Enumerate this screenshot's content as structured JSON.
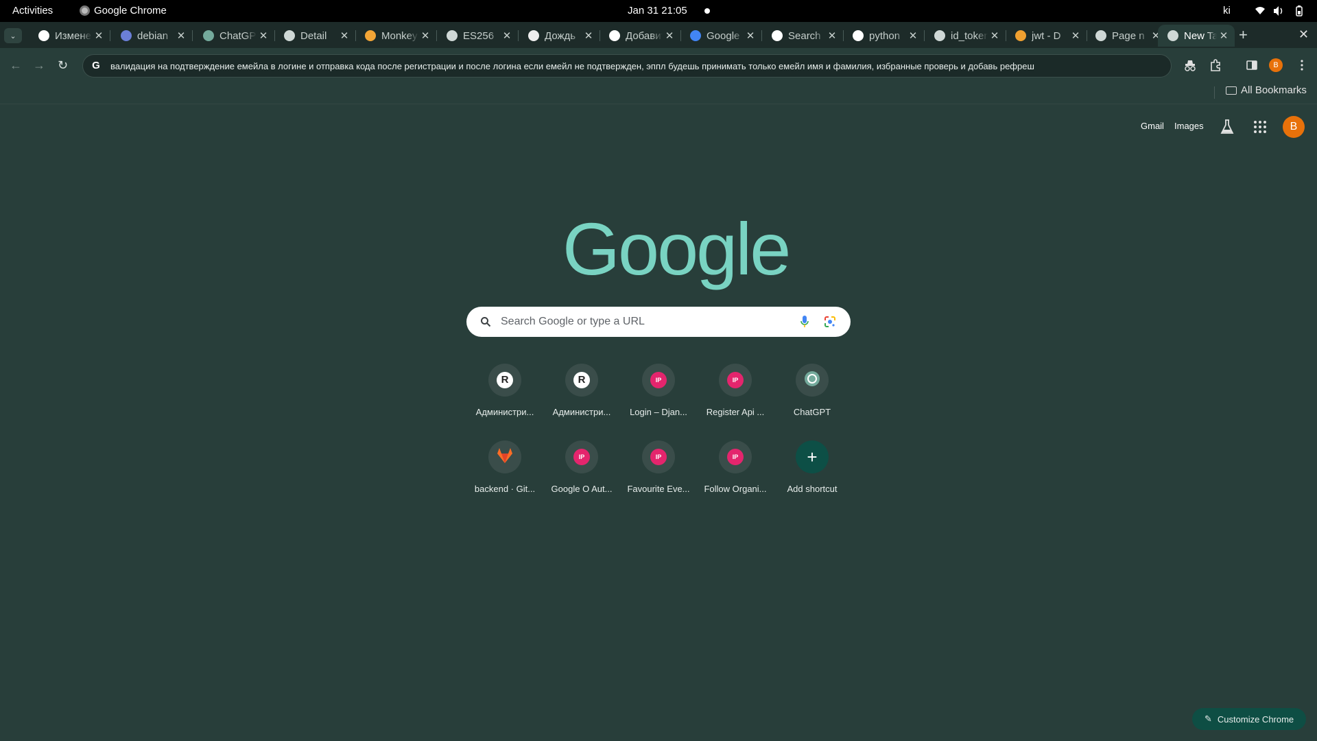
{
  "system_bar": {
    "activities": "Activities",
    "app_name": "Google Chrome",
    "clock": "Jan 31  21:05",
    "keyboard_layout": "ki"
  },
  "tabs": [
    {
      "title": "Изменение",
      "favicon": "R"
    },
    {
      "title": "debian",
      "favicon": "debian"
    },
    {
      "title": "ChatGPT",
      "favicon": "chatgpt"
    },
    {
      "title": "Detail",
      "favicon": "globe"
    },
    {
      "title": "Monkey",
      "favicon": "mt"
    },
    {
      "title": "ES256",
      "favicon": "apple"
    },
    {
      "title": "Дождь",
      "favicon": "image"
    },
    {
      "title": "Добавить",
      "favicon": "R"
    },
    {
      "title": "Google",
      "favicon": "translate"
    },
    {
      "title": "Search",
      "favicon": "cube"
    },
    {
      "title": "python",
      "favicon": "google"
    },
    {
      "title": "id_token",
      "favicon": "apple"
    },
    {
      "title": "jwt - D",
      "favicon": "flame"
    },
    {
      "title": "Page n",
      "favicon": "globe"
    },
    {
      "title": "New Tab",
      "favicon": "chrome",
      "active": true
    }
  ],
  "omnibox": {
    "text": "валидация на подтверждение емейла в логине и отправка кода после регистрации и после логина если емейл не подтвержден, эппл будешь принимать только емейл имя и фамилия, избранные проверь  и добавь рефреш"
  },
  "profile_initial": "B",
  "bookmarks_bar": {
    "all_bookmarks": "All Bookmarks"
  },
  "ntp": {
    "gmail": "Gmail",
    "images": "Images",
    "logo": "Google",
    "search_placeholder": "Search Google or type a URL",
    "shortcuts": [
      {
        "label": "Администри...",
        "icon": "R"
      },
      {
        "label": "Администри...",
        "icon": "R"
      },
      {
        "label": "Login – Djan...",
        "icon": "IP"
      },
      {
        "label": "Register Api ...",
        "icon": "IP"
      },
      {
        "label": "ChatGPT",
        "icon": "chatgpt"
      },
      {
        "label": "backend · Git...",
        "icon": "gitlab"
      },
      {
        "label": "Google O Aut...",
        "icon": "IP"
      },
      {
        "label": "Favourite Eve...",
        "icon": "IP"
      },
      {
        "label": "Follow Organi...",
        "icon": "IP"
      },
      {
        "label": "Add shortcut",
        "icon": "plus"
      }
    ],
    "customize": "Customize Chrome"
  },
  "colors": {
    "background": "#283e3a",
    "tabstrip": "#1d2b29",
    "logo": "#79d3c2",
    "avatar": "#e8710a",
    "ip_badge": "#e4256d"
  }
}
